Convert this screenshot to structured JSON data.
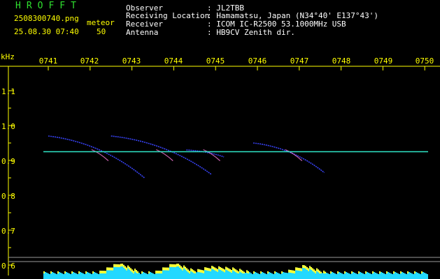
{
  "header": {
    "app_title": "HROFFT",
    "filename": "2508300740.png",
    "datetime": "25.08.30 07:40",
    "mode_label": "meteor",
    "count": "50"
  },
  "station_info": {
    "labels": [
      "Observer",
      "Receiving Location",
      "Receiver",
      "Antenna"
    ],
    "values": [
      ": JL2TBB",
      ": Hamamatsu, Japan (N34°40' E137°43')",
      ": ICOM IC-R2500 53.1000MHz USB",
      ": HB9CV Zenith dir."
    ]
  },
  "chart_data": {
    "type": "heatmap",
    "x_unit": "time (HHMM)",
    "x_ticks": [
      "0741",
      "0742",
      "0743",
      "0744",
      "0745",
      "0746",
      "0747",
      "0748",
      "0749",
      "0750"
    ],
    "y_unit": "kHz",
    "y_ticks": [
      "1.1",
      "1.0",
      "0.9",
      "0.8",
      "0.7",
      "0.6"
    ],
    "y_range": [
      0.6,
      1.15
    ],
    "carrier_khz": 0.925,
    "carrier_color": "#2fe6c8",
    "echo_color": "#3a46ff",
    "echoes": [
      {
        "t_start": 0.0,
        "t_end": 2.3,
        "f_start": 0.97,
        "f_end": 0.85
      },
      {
        "t_start": 1.5,
        "t_end": 3.9,
        "f_start": 0.97,
        "f_end": 0.86
      },
      {
        "t_start": 3.3,
        "t_end": 4.2,
        "f_start": 0.93,
        "f_end": 0.91
      },
      {
        "t_start": 4.9,
        "t_end": 6.6,
        "f_start": 0.95,
        "f_end": 0.865
      }
    ],
    "baseline_color": "#23d8ff"
  }
}
